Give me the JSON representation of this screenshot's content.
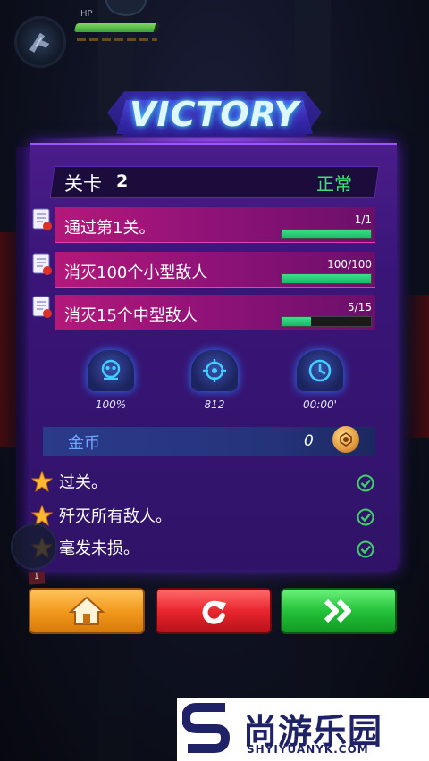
{
  "hud": {
    "hp_label": "HP",
    "hp_fraction": 0.95
  },
  "title": "VICTORY",
  "stage": {
    "label": "关卡",
    "number": "2",
    "status": "正常"
  },
  "missions": [
    {
      "text": "通过第1关。",
      "count": "1/1",
      "progress": 1.0
    },
    {
      "text": "消灭100个小型敌人",
      "count": "100/100",
      "progress": 1.0
    },
    {
      "text": "消灭15个中型敌人",
      "count": "5/15",
      "progress": 0.333
    }
  ],
  "stats": [
    {
      "icon": "skull-icon",
      "value": "100%"
    },
    {
      "icon": "crosshair-icon",
      "value": "812"
    },
    {
      "icon": "clock-icon",
      "value": "00:00'"
    }
  ],
  "gold": {
    "label": "金币",
    "value": "0"
  },
  "objectives": [
    {
      "text": "过关。",
      "done": true
    },
    {
      "text": "歼灭所有敌人。",
      "done": true
    },
    {
      "text": "毫发未损。",
      "done": true
    }
  ],
  "buttons": {
    "home": "home-icon",
    "retry": "retry-icon",
    "next": "next-icon"
  },
  "side_badge": "1",
  "watermark": {
    "cn": "尚游乐园",
    "en": "SHYIYUANYK.COM"
  },
  "colors": {
    "accent_green": "#3fe07a",
    "panel_purple": "#3a1578",
    "mission_pink": "#b4187a",
    "title_blue": "#dff8ff"
  }
}
